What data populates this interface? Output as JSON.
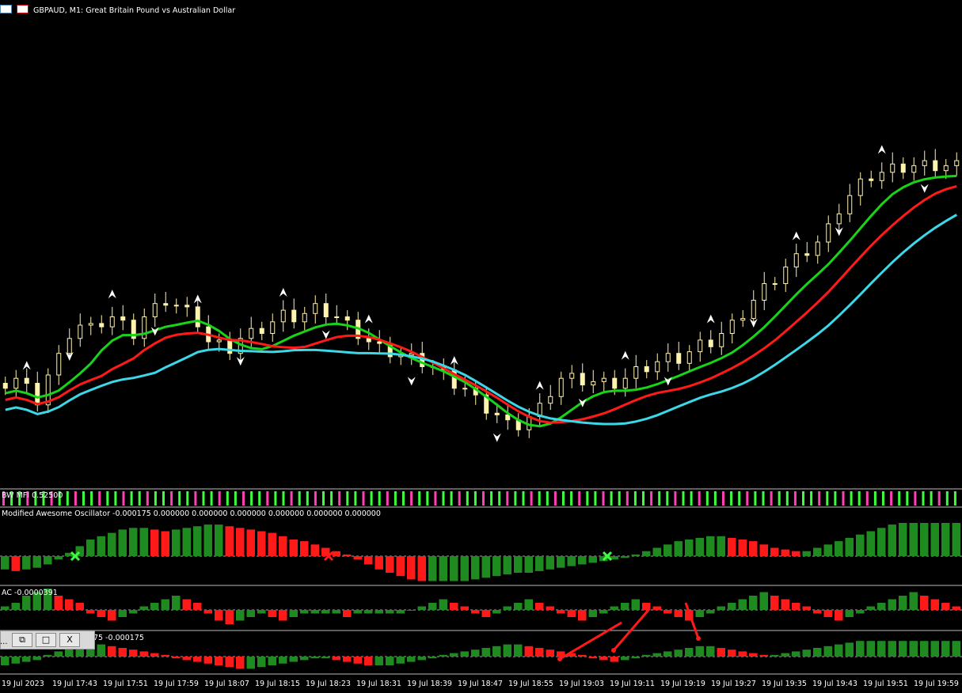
{
  "window": {
    "symbol_title": "GBPAUD, M1:  Great Britain Pound vs Australian Dollar"
  },
  "panels": {
    "mfi": {
      "label": "BW MFI 0.52500"
    },
    "ao": {
      "label": "Modified Awesome Oscillator -0.000175 0.000000 0.000000 0.000000 0.000000 0.000000 0.000000"
    },
    "ac": {
      "label": "AC -0.0000391"
    },
    "ao2": {
      "label": "75 -0.000175"
    }
  },
  "window_buttons": {
    "restore": "⧉",
    "maximize": "□",
    "close": "X",
    "ellipsis": "..."
  },
  "time_axis": [
    "19 Jul 2023",
    "19 Jul 17:43",
    "19 Jul 17:51",
    "19 Jul 17:59",
    "19 Jul 18:07",
    "19 Jul 18:15",
    "19 Jul 18:23",
    "19 Jul 18:31",
    "19 Jul 18:39",
    "19 Jul 18:47",
    "19 Jul 18:55",
    "19 Jul 19:03",
    "19 Jul 19:11",
    "19 Jul 19:19",
    "19 Jul 19:27",
    "19 Jul 19:35",
    "19 Jul 19:43",
    "19 Jul 19:51",
    "19 Jul 19:59"
  ],
  "chart_data": {
    "type": "line",
    "symbol": "GBPAUD",
    "timeframe": "M1",
    "price_trend": [
      55,
      58,
      52,
      45,
      60,
      70,
      85,
      90,
      88,
      92,
      95,
      90,
      85,
      95,
      100,
      105,
      102,
      98,
      92,
      80,
      78,
      76,
      82,
      85,
      88,
      92,
      96,
      95,
      97,
      100,
      98,
      95,
      90,
      85,
      80,
      76,
      74,
      72,
      70,
      68,
      65,
      60,
      55,
      52,
      45,
      40,
      36,
      30,
      30,
      35,
      40,
      50,
      58,
      58,
      57,
      56,
      55,
      55,
      58,
      62,
      65,
      68,
      70,
      70,
      74,
      78,
      80,
      85,
      90,
      97,
      105,
      112,
      118,
      125,
      130,
      135,
      140,
      148,
      160,
      168,
      175,
      180,
      182,
      184,
      185,
      186,
      186,
      186,
      186,
      186
    ],
    "series": [
      {
        "name": "",
        "color": "#19d319"
      },
      {
        "name": "",
        "color": "#ff1a1a"
      },
      {
        "name": "",
        "color": "#3cd8e8"
      }
    ],
    "oscillators": {
      "mfi_colors": [
        "#ff3fb4",
        "#3aff3a"
      ],
      "ao": [
        -8,
        -9,
        -8,
        -7,
        -5,
        -2,
        2,
        6,
        10,
        12,
        14,
        16,
        17,
        17,
        16,
        15,
        16,
        17,
        18,
        19,
        19,
        18,
        17,
        16,
        15,
        14,
        12,
        10,
        9,
        7,
        5,
        3,
        1,
        -2,
        -5,
        -8,
        -10,
        -12,
        -14,
        -15,
        -15,
        -15,
        -15,
        -15,
        -14,
        -13,
        -12,
        -11,
        -10,
        -10,
        -9,
        -8,
        -7,
        -6,
        -5,
        -4,
        -3,
        -2,
        -1,
        1,
        3,
        5,
        7,
        9,
        10,
        11,
        12,
        12,
        11,
        10,
        9,
        7,
        5,
        4,
        3,
        3,
        5,
        7,
        9,
        11,
        13,
        15,
        17,
        19,
        20,
        20,
        20,
        20,
        20,
        20
      ],
      "ac": [
        1,
        2,
        4,
        5,
        6,
        4,
        3,
        2,
        -1,
        -2,
        -3,
        -2,
        -1,
        1,
        2,
        3,
        4,
        3,
        2,
        -1,
        -3,
        -4,
        -3,
        -2,
        -1,
        -2,
        -3,
        -2,
        -1,
        -1,
        -1,
        -1,
        -2,
        -1,
        -1,
        -1,
        -1,
        -1,
        0,
        1,
        2,
        3,
        2,
        1,
        -1,
        -2,
        -1,
        1,
        2,
        3,
        2,
        1,
        -1,
        -2,
        -3,
        -2,
        -1,
        1,
        2,
        3,
        2,
        1,
        -1,
        -2,
        -3,
        -2,
        -1,
        1,
        2,
        3,
        4,
        5,
        4,
        3,
        2,
        1,
        -1,
        -2,
        -3,
        -2,
        -1,
        1,
        2,
        3,
        4,
        5,
        4,
        3,
        2,
        1
      ],
      "ao2": [
        -5,
        -4,
        -3,
        -2,
        1,
        3,
        5,
        6,
        7,
        7,
        6,
        5,
        4,
        3,
        2,
        1,
        -1,
        -2,
        -3,
        -4,
        -5,
        -6,
        -7,
        -7,
        -6,
        -5,
        -4,
        -3,
        -2,
        -1,
        -1,
        -2,
        -3,
        -4,
        -5,
        -5,
        -5,
        -4,
        -3,
        -2,
        -1,
        1,
        2,
        3,
        4,
        5,
        6,
        7,
        7,
        6,
        5,
        4,
        3,
        2,
        1,
        -1,
        -2,
        -3,
        -2,
        -1,
        1,
        2,
        3,
        4,
        5,
        6,
        6,
        5,
        4,
        3,
        2,
        1,
        1,
        2,
        3,
        4,
        5,
        6,
        7,
        8,
        9,
        9,
        9,
        9,
        9,
        9,
        9,
        9,
        9,
        9
      ]
    }
  }
}
